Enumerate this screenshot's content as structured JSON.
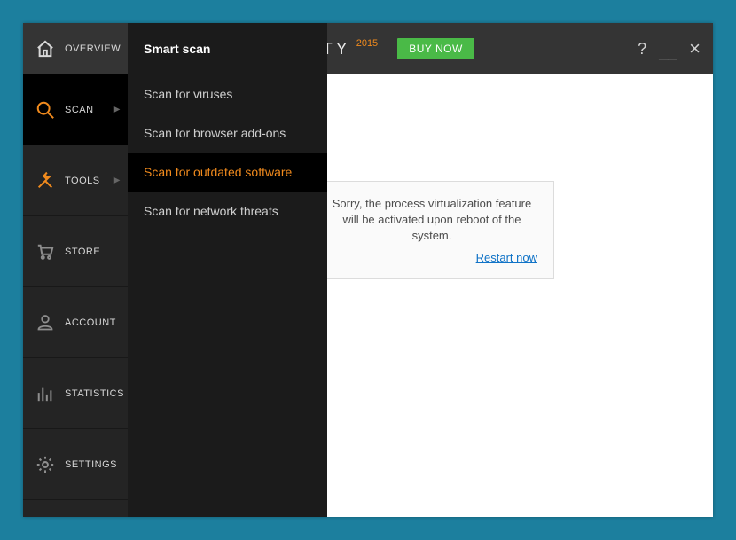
{
  "titlebar": {
    "title_visible_fragment": "ERNET SECURITY",
    "year": "2015",
    "buy_label": "BUY NOW"
  },
  "sidebar": {
    "items": [
      {
        "label": "OVERVIEW"
      },
      {
        "label": "SCAN"
      },
      {
        "label": "TOOLS"
      },
      {
        "label": "STORE"
      },
      {
        "label": "ACCOUNT"
      },
      {
        "label": "STATISTICS"
      },
      {
        "label": "SETTINGS"
      }
    ]
  },
  "submenu": {
    "items": [
      {
        "label": "Smart scan"
      },
      {
        "label": "Scan for viruses"
      },
      {
        "label": "Scan for browser add-ons"
      },
      {
        "label": "Scan for outdated software"
      },
      {
        "label": "Scan for network threats"
      }
    ]
  },
  "notice": {
    "text": "Sorry, the process virtualization feature will be activated upon reboot of the system.",
    "link": "Restart now"
  },
  "colors": {
    "accent": "#f08a1d",
    "green": "#4aba47"
  }
}
